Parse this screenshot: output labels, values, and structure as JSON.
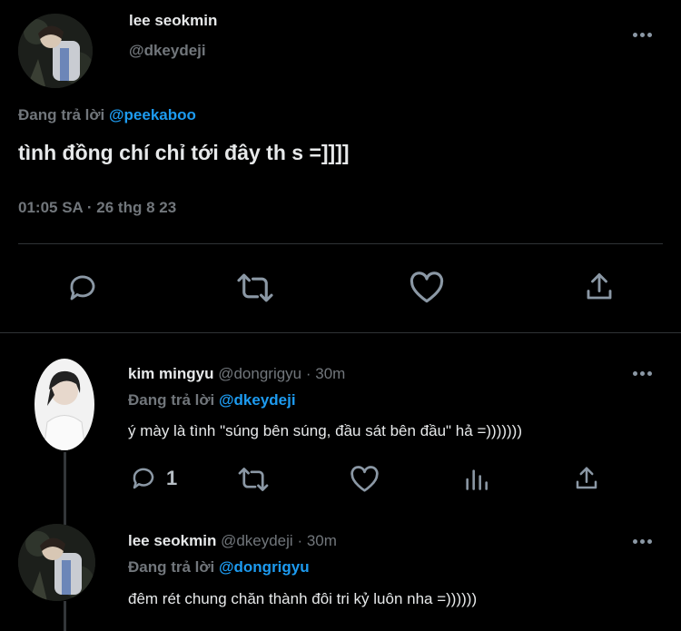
{
  "main_tweet": {
    "display_name": "lee seokmin",
    "handle": "@dkeydeji",
    "replying_prefix": "Đang trả lời",
    "replying_to": "@peekaboo",
    "text": "tình đồng chí chỉ tới đây th s =]]]]",
    "timestamp": "01:05 SA · 26 thg 8 23",
    "actions": [
      "reply-icon",
      "retweet-icon",
      "like-icon",
      "share-icon"
    ]
  },
  "replies": [
    {
      "display_name": "kim mingyu",
      "handle": "@dongrigyu",
      "time": "· 30m",
      "replying_prefix": "Đang trả lời",
      "replying_to": "@dkeydeji",
      "text": "ý mày là tình \"súng bên súng, đầu sát bên đầu\" hả =)))))))",
      "reply_count": "1",
      "actions": [
        "reply-icon",
        "retweet-icon",
        "like-icon",
        "analytics-icon",
        "share-icon"
      ]
    },
    {
      "display_name": "lee seokmin",
      "handle": "@dkeydeji",
      "time": "· 30m",
      "replying_prefix": "Đang trả lời",
      "replying_to": "@dongrigyu",
      "text": "đêm rét chung chăn thành đôi tri kỷ luôn nha =))))))"
    }
  ],
  "colors": {
    "background": "#000000",
    "text": "#e7e9ea",
    "muted": "#71767b",
    "link": "#1d9bf0",
    "divider": "#2f3336"
  }
}
